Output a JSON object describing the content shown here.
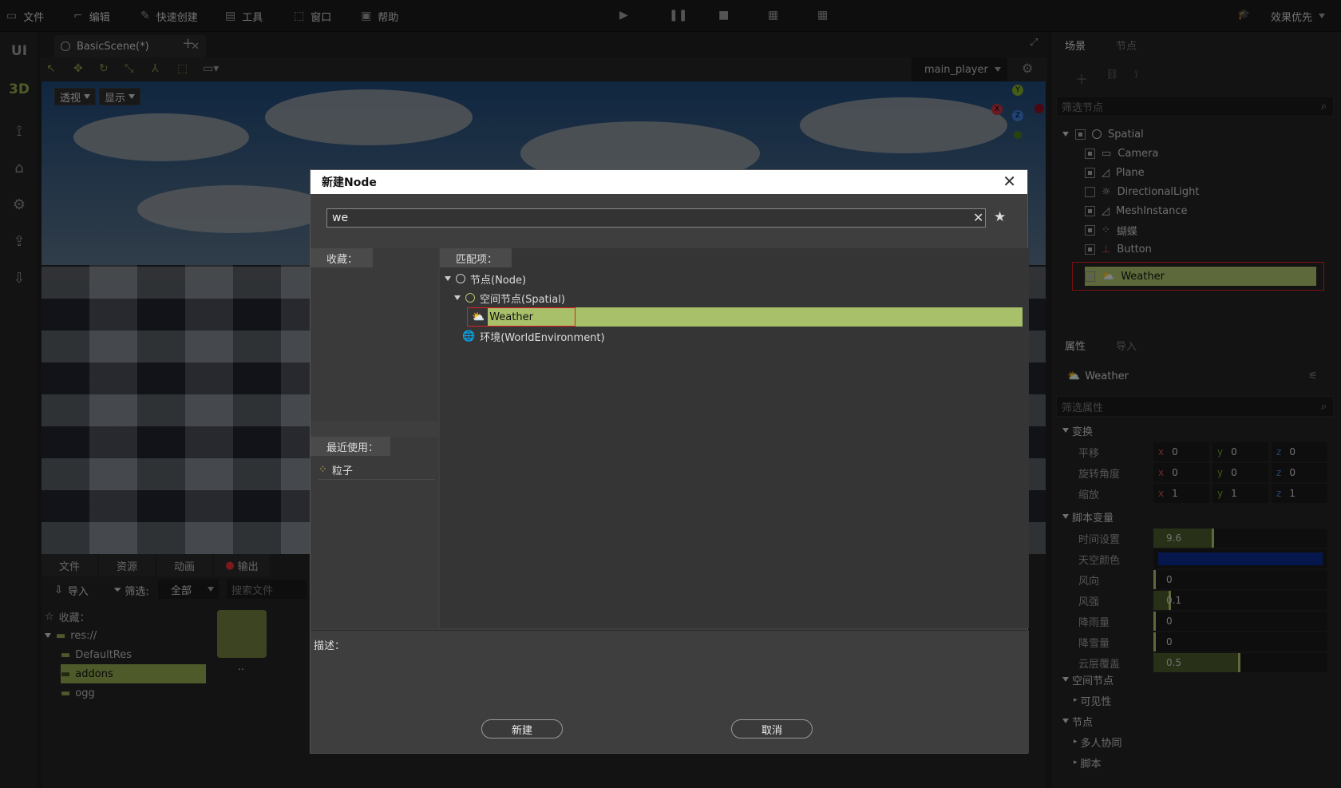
{
  "menubar": {
    "items": [
      {
        "label": "文件",
        "icon": "folder-icon"
      },
      {
        "label": "编辑",
        "icon": "crop-icon"
      },
      {
        "label": "快速创建",
        "icon": "edit-icon"
      },
      {
        "label": "工具",
        "icon": "window-icon"
      },
      {
        "label": "窗口",
        "icon": "frame-icon"
      },
      {
        "label": "帮助",
        "icon": "help-icon"
      }
    ],
    "mode_label": "效果优先",
    "play_controls": [
      "play-icon",
      "pause-icon",
      "stop-icon",
      "clapper-icon",
      "clapper-alt-icon"
    ]
  },
  "left_toolbar": {
    "ui_label": "UI",
    "three_d_label": "3D"
  },
  "scene_tab": {
    "title": "BasicScene(*)",
    "add_label": "+"
  },
  "viewport": {
    "perspective_label": "透视",
    "display_label": "显示",
    "camera_select": "main_player",
    "gizmo_axes": {
      "x": "X",
      "y": "Y",
      "z": "Z"
    }
  },
  "bottom_panel": {
    "tabs": [
      "文件",
      "资源",
      "动画",
      "输出"
    ],
    "import_label": "导入",
    "filter_label": "筛选:",
    "filter_value": "全部",
    "search_placeholder": "搜索文件",
    "tree": [
      {
        "label": "收藏：",
        "kind": "favorite"
      },
      {
        "label": "res://",
        "kind": "folder"
      },
      {
        "label": "DefaultRes",
        "kind": "folder"
      },
      {
        "label": "addons",
        "kind": "folder",
        "selected": true
      },
      {
        "label": "ogg",
        "kind": "folder"
      }
    ],
    "grid_items": [
      ".."
    ]
  },
  "right_panel": {
    "scene_tabs": [
      "场景",
      "节点"
    ],
    "filter_nodes_placeholder": "筛选节点",
    "nodes": [
      {
        "label": "Spatial",
        "icon": "spatial-icon"
      },
      {
        "label": "Camera",
        "icon": "camera-icon"
      },
      {
        "label": "Plane",
        "icon": "mesh-icon"
      },
      {
        "label": "DirectionalLight",
        "icon": "light-icon"
      },
      {
        "label": "MeshInstance",
        "icon": "mesh-icon"
      },
      {
        "label": "蝴蝶",
        "icon": "particles-icon"
      },
      {
        "label": "Button",
        "icon": "button-icon"
      },
      {
        "label": "Weather",
        "icon": "weather-icon",
        "selected": true
      }
    ],
    "inspector_tabs": [
      "属性",
      "导入"
    ],
    "inspected_node": "Weather",
    "filter_props_placeholder": "筛选属性",
    "sections": {
      "transform": "变换",
      "script_vars": "脚本变量",
      "spatial": "空间节点",
      "visibility": "可见性",
      "node": "节点",
      "multiplayer": "多人协同",
      "script": "脚本"
    },
    "transform_rows": [
      {
        "label": "平移",
        "x": "0",
        "y": "0",
        "z": "0"
      },
      {
        "label": "旋转角度",
        "x": "0",
        "y": "0",
        "z": "0"
      },
      {
        "label": "缩放",
        "x": "1",
        "y": "1",
        "z": "1"
      }
    ],
    "script_rows": [
      {
        "label": "时间设置",
        "value": "9.6",
        "fill": 0.35
      },
      {
        "label": "天空颜色",
        "value": "",
        "color": "#0b2a8c"
      },
      {
        "label": "风向",
        "value": "0",
        "fill": 0.0
      },
      {
        "label": "风强",
        "value": "0.1",
        "fill": 0.1
      },
      {
        "label": "降雨量",
        "value": "0",
        "fill": 0.0
      },
      {
        "label": "降雪量",
        "value": "0",
        "fill": 0.0
      },
      {
        "label": "云层覆盖",
        "value": "0.5",
        "fill": 0.5
      }
    ]
  },
  "dialog": {
    "title": "新建Node",
    "search_value": "we",
    "favorites_label": "收藏：",
    "recent_label": "最近使用：",
    "recent_items": [
      {
        "label": "粒子",
        "icon": "particles-icon"
      }
    ],
    "matches_label": "匹配项：",
    "matches": [
      {
        "label": "节点(Node)",
        "depth": 0,
        "icon": "node-icon"
      },
      {
        "label": "空间节点(Spatial)",
        "depth": 1,
        "icon": "spatial-icon"
      },
      {
        "label": "Weather",
        "depth": 2,
        "icon": "weather-icon",
        "selected": true
      },
      {
        "label": "环境(WorldEnvironment)",
        "depth": 1,
        "icon": "globe-icon"
      }
    ],
    "description_label": "描述：",
    "create_label": "新建",
    "cancel_label": "取消"
  },
  "colors": {
    "accent": "#a9c06a",
    "highlight_border": "#e02020",
    "output_dot": "#e03030",
    "sky_color": "#0b2a8c"
  }
}
